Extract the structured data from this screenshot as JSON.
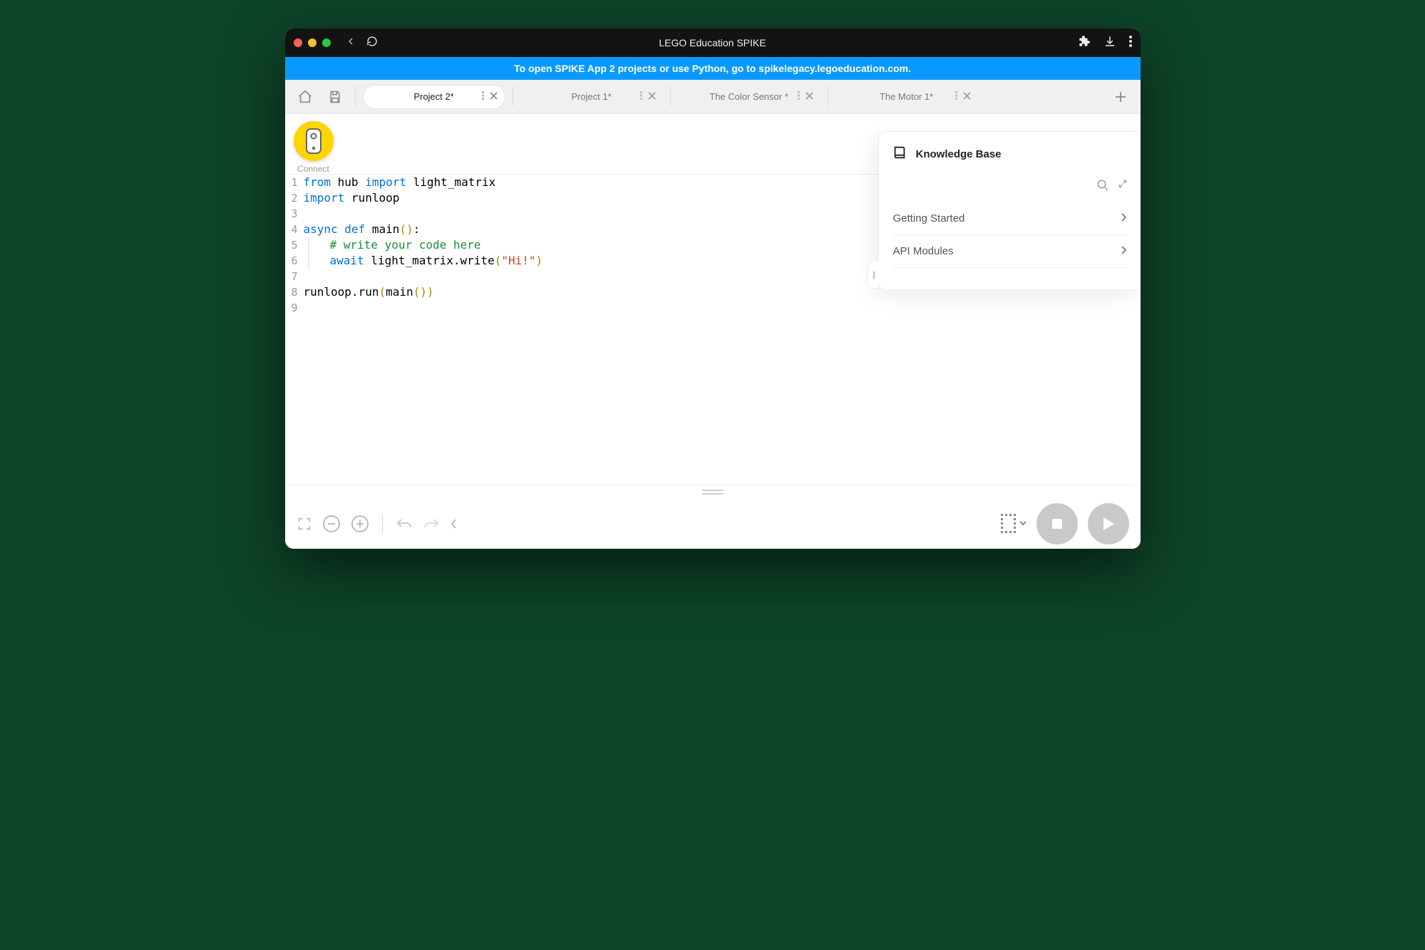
{
  "titlebar": {
    "title": "LEGO Education SPIKE"
  },
  "banner": {
    "text": "To open SPIKE App 2 projects or use Python, go to spikelegacy.legoeducation.com."
  },
  "tabs": [
    {
      "label": "Project 2*",
      "active": true
    },
    {
      "label": "Project 1*",
      "active": false
    },
    {
      "label": "The Color Sensor *",
      "active": false
    },
    {
      "label": "The Motor 1*",
      "active": false
    }
  ],
  "connect": {
    "label": "Connect"
  },
  "code_lines": {
    "l1_from": "from",
    "l1_hub": " hub ",
    "l1_import": "import",
    "l1_lm": " light_matrix",
    "l2_import": "import",
    "l2_runloop": " runloop",
    "l4_async": "async ",
    "l4_def": "def",
    "l4_main": " main",
    "l4_paren": "()",
    "l4_colon": ":",
    "l5_comment": "# write your code here",
    "l6_await": "await",
    "l6_call": " light_matrix.write",
    "l6_open": "(",
    "l6_str": "\"Hi!\"",
    "l6_close": ")",
    "l8_run": "runloop.run",
    "l8_open": "(",
    "l8_main": "main",
    "l8_paren": "()",
    "l8_close": ")"
  },
  "line_numbers": {
    "n1": "1",
    "n2": "2",
    "n3": "3",
    "n4": "4",
    "n5": "5",
    "n6": "6",
    "n7": "7",
    "n8": "8",
    "n9": "9"
  },
  "kb": {
    "title": "Knowledge Base",
    "items": [
      {
        "label": "Getting Started"
      },
      {
        "label": "API Modules"
      }
    ]
  }
}
